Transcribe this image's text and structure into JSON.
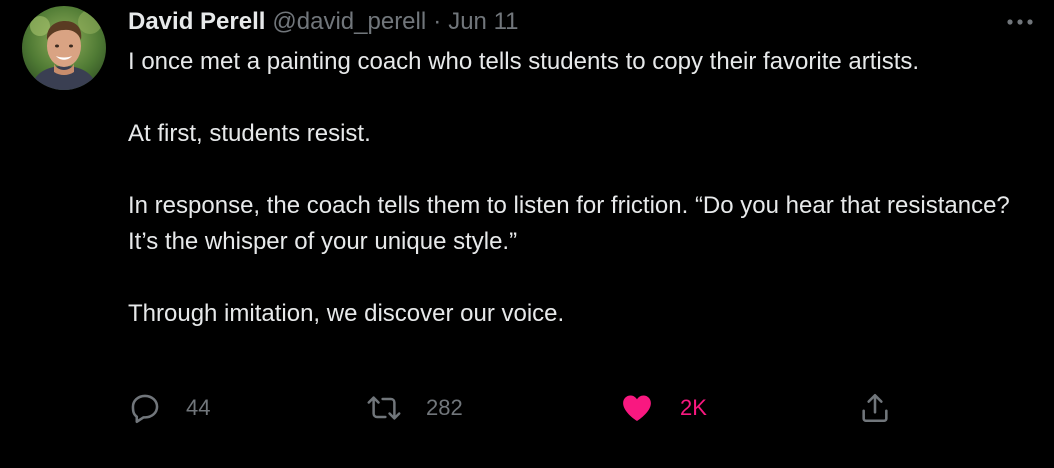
{
  "author": {
    "name": "David Perell",
    "handle": "@david_perell",
    "separator": "·",
    "date": "Jun 11",
    "avatar_icon": "profile-photo"
  },
  "tweet": {
    "paragraphs": [
      "I once met a painting coach who tells students to copy their favorite artists.",
      "At first, students resist.",
      "In response, the coach tells them to listen for friction. “Do you hear that resistance? It’s the whisper of your unique style.”",
      "Through imitation, we discover our voice."
    ]
  },
  "actions": {
    "reply": {
      "icon": "reply-icon",
      "count": "44"
    },
    "retweet": {
      "icon": "retweet-icon",
      "count": "282"
    },
    "like": {
      "icon": "heart-icon",
      "count": "2K",
      "liked": true
    },
    "share": {
      "icon": "share-icon"
    },
    "more": {
      "icon": "more-icon"
    }
  },
  "colors": {
    "background": "#000000",
    "text": "#e7e9ea",
    "muted": "#71767b",
    "like": "#f91880"
  }
}
